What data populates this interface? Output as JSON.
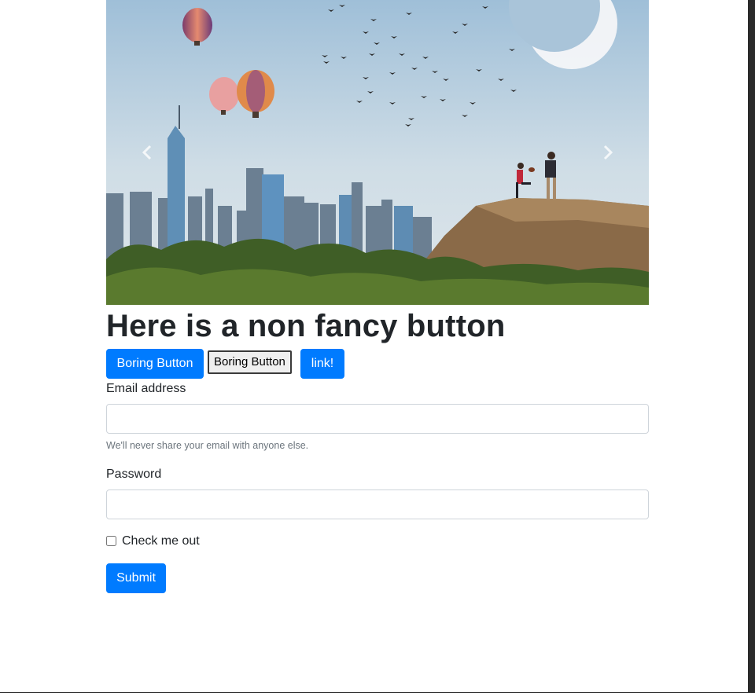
{
  "carousel": {
    "image_alt": "city skyline with hot air balloons, birds, moon and people on a hill",
    "prev_icon": "chevron-left-icon",
    "next_icon": "chevron-right-icon"
  },
  "heading": "Here is a non fancy button",
  "buttons": {
    "primary_label": "Boring Button",
    "plain_label": "Boring Button",
    "link_label": "link!"
  },
  "form": {
    "email_label": "Email address",
    "email_value": "",
    "email_help": "We'll never share your email with anyone else.",
    "password_label": "Password",
    "password_value": "",
    "checkbox_label": "Check me out",
    "checkbox_checked": false,
    "submit_label": "Submit"
  },
  "colors": {
    "primary": "#007bff",
    "text": "#212529",
    "muted": "#6c757d",
    "input_border": "#ced4da"
  }
}
